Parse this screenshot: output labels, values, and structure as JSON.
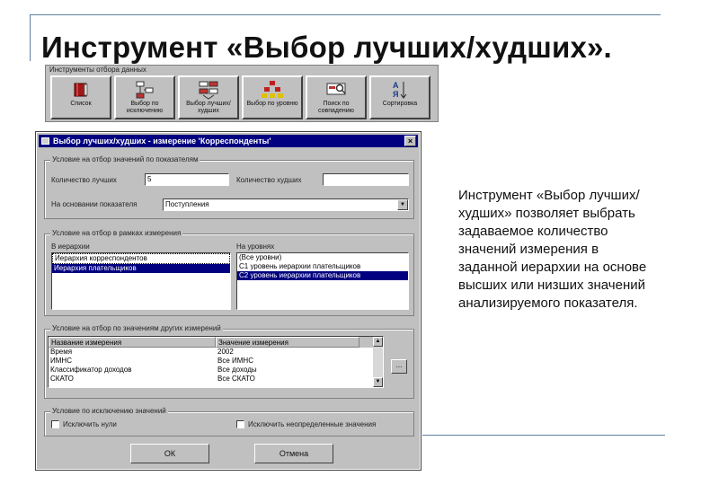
{
  "slide": {
    "title": "Инструмент «Выбор лучших/худших».",
    "description": "Инструмент «Выбор лучших/худших» позволяет выбрать задаваемое количество значений измерения в заданной иерархии на основе высших или низших значений анализируемого показателя."
  },
  "toolbar": {
    "caption": "Инструменты отбора данных",
    "buttons": [
      {
        "label": "Список",
        "icon": "book-icon"
      },
      {
        "label": "Выбор по исключению",
        "icon": "exclude-select-icon"
      },
      {
        "label": "Выбор лучших/худших",
        "icon": "best-worst-icon"
      },
      {
        "label": "Выбор по уровню",
        "icon": "level-select-icon"
      },
      {
        "label": "Поиск по совпадению",
        "icon": "search-match-icon"
      },
      {
        "label": "Сортировка",
        "icon": "sort-az-icon"
      }
    ]
  },
  "dialog": {
    "title": "Выбор лучших/худших - измерение 'Корреспонденты'",
    "close": "×",
    "group1": {
      "legend": "Условие на отбор значений по показателям",
      "best_count_label": "Количество лучших",
      "best_count_value": "5",
      "worst_count_label": "Количество худших",
      "worst_count_value": "",
      "basis_label": "На основании показателя",
      "basis_value": "Поступления"
    },
    "group2": {
      "legend": "Условие на отбор в рамках измерения",
      "hierarchy_label": "В иерархии",
      "hierarchies": [
        "Иерархия корреспондентов",
        "Иерархия плательщиков"
      ],
      "levels_label": "На уровнях",
      "levels": [
        "(Все уровни)",
        "С1 уровень иерархии плательщиков",
        "С2 уровень иерархии плательщиков"
      ]
    },
    "group3": {
      "legend": "Условие на отбор по значениям других измерений",
      "col_name": "Название измерения",
      "col_value": "Значение измерения",
      "rows": [
        {
          "name": "Время",
          "value": "2002"
        },
        {
          "name": "ИМНС",
          "value": "Все ИМНС"
        },
        {
          "name": "Классификатор доходов",
          "value": "Все доходы"
        },
        {
          "name": "СКАТО",
          "value": "Все СКАТО"
        }
      ],
      "browse": "..."
    },
    "group4": {
      "legend": "Условие по исключению значений",
      "exclude_zeros": "Исключить нули",
      "exclude_undefined": "Исключить неопределенные значения"
    },
    "ok": "ОК",
    "cancel": "Отмена"
  },
  "colors": {
    "titlebar": "#000080",
    "selection": "#000080",
    "window_face": "#c0c0c0"
  }
}
